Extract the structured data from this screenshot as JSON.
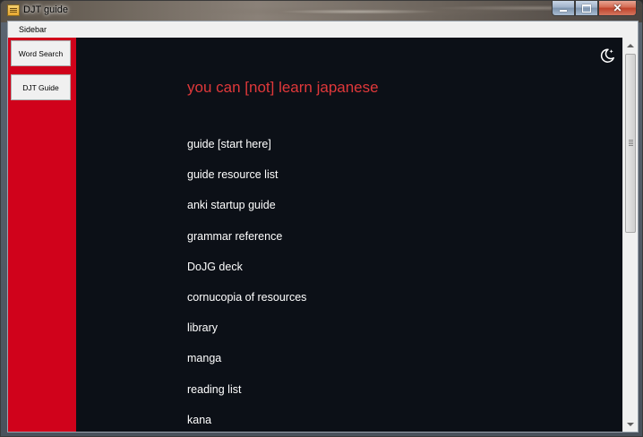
{
  "window": {
    "title": "DJT guide",
    "icon": "app-window-icon",
    "controls": {
      "minimize_icon": "minimize-icon",
      "maximize_icon": "maximize-icon",
      "close_icon": "close-icon"
    }
  },
  "menubar": {
    "items": [
      {
        "label": "Sidebar"
      }
    ]
  },
  "sidebar": {
    "background": "#d0021b",
    "buttons": [
      {
        "label": "Word Search"
      },
      {
        "label": "DJT Guide"
      }
    ]
  },
  "content": {
    "background": "#0c1017",
    "theme_toggle_icon": "moon-icon",
    "title": "you can [not] learn japanese",
    "title_color": "#e0383a",
    "links": [
      {
        "label": "guide [start here]"
      },
      {
        "label": "guide resource list"
      },
      {
        "label": "anki startup guide"
      },
      {
        "label": "grammar reference"
      },
      {
        "label": "DoJG deck"
      },
      {
        "label": "cornucopia of resources"
      },
      {
        "label": "library"
      },
      {
        "label": "manga"
      },
      {
        "label": "reading list"
      },
      {
        "label": "kana"
      }
    ]
  }
}
